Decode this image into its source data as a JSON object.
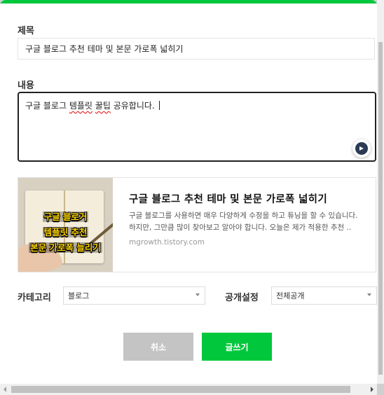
{
  "form": {
    "title_label": "제목",
    "title_value": "구글 블로그 추천 테마 및 본문 가로폭 넓히기",
    "content_label": "내용",
    "content_pre": "구글 블로그 ",
    "content_spell1": "템플릿",
    "content_mid": " ",
    "content_spell2": "꿀팁",
    "content_post": " 공유합니다. "
  },
  "link_card": {
    "thumb_line1": "구글 블로거",
    "thumb_line2": "템플릿 추천",
    "thumb_line3": "본문 가로폭 늘리기",
    "title": "구글 블로그 추천 테마 및 본문 가로폭 넓히기",
    "desc_line1": "구글 블로그를 사용하면 매우 다양하게 수정을 하고 튜닝을 할 수 있습니다.",
    "desc_line2": "하지만, 그만큼 많이 찾아보고 알아야 합니다. 오늘은 제가 적용한 추천 ..",
    "url": "mgrowth.tistory.com"
  },
  "settings": {
    "category_label": "카테고리",
    "category_value": "블로그",
    "visibility_label": "공개설정",
    "visibility_value": "전체공개"
  },
  "actions": {
    "cancel_label": "취소",
    "submit_label": "글쓰기"
  },
  "colors": {
    "accent": "#00c73c",
    "cancel": "#c4c4c4"
  },
  "icons": {
    "assistant": "grammar-assistant-icon"
  }
}
